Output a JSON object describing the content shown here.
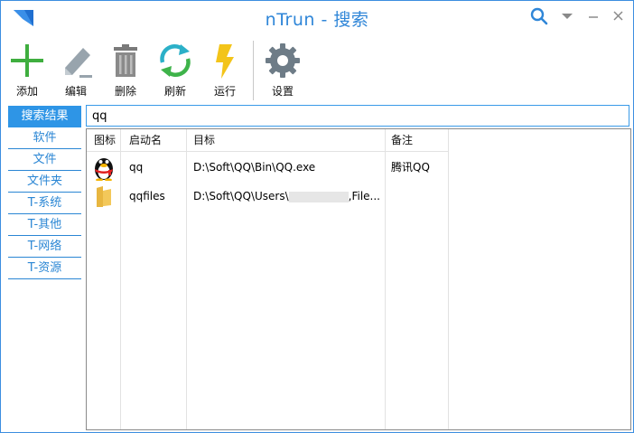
{
  "window": {
    "title": "nTrun - 搜索",
    "accent": "#2e95e6"
  },
  "titlebar": {
    "icons": [
      "search-icon",
      "dropdown-icon",
      "minimize-icon",
      "close-icon"
    ]
  },
  "toolbar": {
    "add_label": "添加",
    "edit_label": "编辑",
    "delete_label": "删除",
    "refresh_label": "刷新",
    "run_label": "运行",
    "settings_label": "设置"
  },
  "sidebar": {
    "items": [
      {
        "label": "搜索结果",
        "active": true
      },
      {
        "label": "软件"
      },
      {
        "label": "文件"
      },
      {
        "label": "文件夹"
      },
      {
        "label": "T-系统"
      },
      {
        "label": "T-其他"
      },
      {
        "label": "T-网络"
      },
      {
        "label": "T-资源"
      }
    ]
  },
  "search": {
    "value": "qq"
  },
  "table": {
    "columns": [
      "图标",
      "启动名",
      "目标",
      "备注"
    ],
    "rows": [
      {
        "icon": "qq-penguin-icon",
        "name": "qq",
        "target": "D:\\Soft\\QQ\\Bin\\QQ.exe",
        "note": "腾讯QQ"
      },
      {
        "icon": "folder-icon",
        "name": "qqfiles",
        "target_prefix": "D:\\Soft\\QQ\\Users\\",
        "target_suffix": ",File...",
        "note": ""
      }
    ]
  }
}
